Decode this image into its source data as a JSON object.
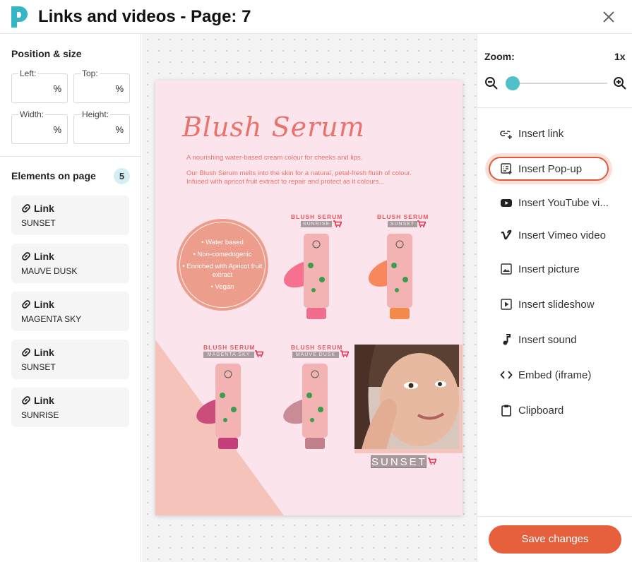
{
  "header": {
    "title": "Links and videos - Page: 7"
  },
  "left": {
    "position_title": "Position & size",
    "fields": {
      "left": {
        "label": "Left:",
        "unit": "%"
      },
      "top": {
        "label": "Top:",
        "unit": "%"
      },
      "width": {
        "label": "Width:",
        "unit": "%"
      },
      "height": {
        "label": "Height:",
        "unit": "%"
      }
    },
    "elements_title": "Elements on page",
    "elements_count": "5",
    "links": [
      {
        "title": "Link",
        "name": "SUNSET"
      },
      {
        "title": "Link",
        "name": "MAUVE DUSK"
      },
      {
        "title": "Link",
        "name": "MAGENTA SKY"
      },
      {
        "title": "Link",
        "name": "SUNSET"
      },
      {
        "title": "Link",
        "name": "SUNRISE"
      }
    ]
  },
  "page": {
    "heading": "Blush Serum",
    "intro": "A nourishing water-based cream colour for cheeks and lips.",
    "desc1": "Our Blush Serum melts into the skin for a natural, petal-fresh flush of colour.",
    "desc2": "Infused with apricot fruit extract to repair and protect as it colours...",
    "bullets": [
      "• Water based",
      "• Non-comedogenic",
      "• Enriched with Apricot fruit extract",
      "• Vegan"
    ],
    "products": [
      {
        "label": "BLUSH SERUM",
        "name": "SUNRISE"
      },
      {
        "label": "BLUSH SERUM",
        "name": "SUNSET"
      },
      {
        "label": "BLUSH SERUM",
        "name": "MAGENTA SKY"
      },
      {
        "label": "BLUSH SERUM",
        "name": "MAUVE DUSK"
      }
    ],
    "photo_tag": "SUNSET",
    "colors": {
      "sunrise": "#f6718f",
      "sunset": "#f7885d",
      "magenta": "#cb4d7c",
      "mauve": "#c98b96"
    }
  },
  "right": {
    "zoom_label": "Zoom:",
    "zoom_value": "1x",
    "zoom_level": 0.0,
    "menu": [
      {
        "label": "Insert link",
        "icon": "link-plus-icon"
      },
      {
        "label": "Insert Pop-up",
        "icon": "popup-icon"
      },
      {
        "label": "Insert YouTube vi...",
        "icon": "youtube-icon"
      },
      {
        "label": "Insert Vimeo video",
        "icon": "vimeo-icon"
      },
      {
        "label": "Insert picture",
        "icon": "picture-icon"
      },
      {
        "label": "Insert slideshow",
        "icon": "slideshow-icon"
      },
      {
        "label": "Insert sound",
        "icon": "music-note-icon"
      },
      {
        "label": "Embed (iframe)",
        "icon": "code-icon"
      },
      {
        "label": "Clipboard",
        "icon": "clipboard-icon"
      }
    ],
    "save_label": "Save changes"
  },
  "accent": "#e6603d"
}
